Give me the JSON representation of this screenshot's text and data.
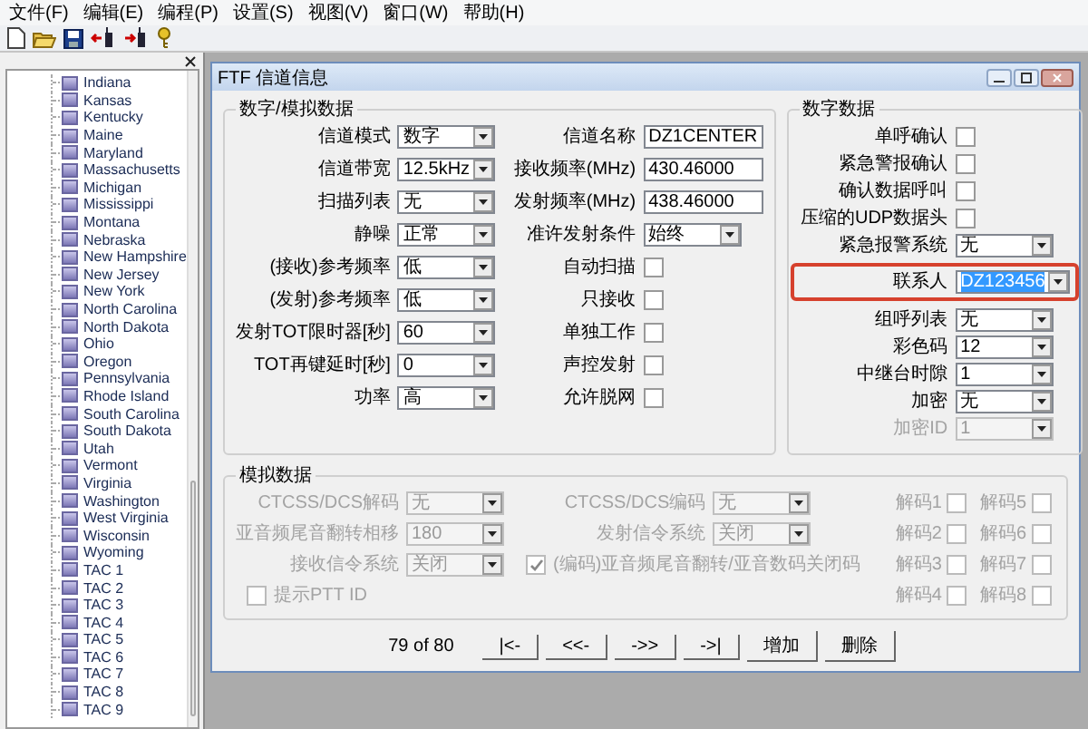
{
  "menu": [
    "文件(F)",
    "编辑(E)",
    "编程(P)",
    "设置(S)",
    "视图(V)",
    "窗口(W)",
    "帮助(H)"
  ],
  "tree": {
    "items": [
      "Indiana",
      "Kansas",
      "Kentucky",
      "Maine",
      "Maryland",
      "Massachusetts",
      "Michigan",
      "Mississippi",
      "Montana",
      "Nebraska",
      "New Hampshire",
      "New Jersey",
      "New York",
      "North Carolina",
      "North Dakota",
      "Ohio",
      "Oregon",
      "Pennsylvania",
      "Rhode Island",
      "South Carolina",
      "South Dakota",
      "Utah",
      "Vermont",
      "Virginia",
      "Washington",
      "West Virginia",
      "Wisconsin",
      "Wyoming",
      "TAC 1",
      "TAC 2",
      "TAC 3",
      "TAC 4",
      "TAC 5",
      "TAC 6",
      "TAC 7",
      "TAC 8",
      "TAC 9"
    ]
  },
  "dialog": {
    "title": "FTF 信道信息",
    "general": {
      "title": "数字/模拟数据",
      "left": [
        {
          "kind": "select",
          "label": "信道模式",
          "value": "数字"
        },
        {
          "kind": "select",
          "label": "信道带宽",
          "value": "12.5kHz"
        },
        {
          "kind": "select",
          "label": "扫描列表",
          "value": "无"
        },
        {
          "kind": "select",
          "label": "静噪",
          "value": "正常"
        },
        {
          "kind": "select",
          "label": "(接收)参考频率",
          "value": "低"
        },
        {
          "kind": "select",
          "label": "(发射)参考频率",
          "value": "低"
        },
        {
          "kind": "select",
          "label": "发射TOT限时器[秒]",
          "value": "60"
        },
        {
          "kind": "select",
          "label": "TOT再键延时[秒]",
          "value": "0"
        },
        {
          "kind": "select",
          "label": "功率",
          "value": "高"
        }
      ],
      "right": [
        {
          "kind": "input",
          "label": "信道名称",
          "value": "DZ1CENTER"
        },
        {
          "kind": "input",
          "label": "接收频率(MHz)",
          "value": "430.46000"
        },
        {
          "kind": "input",
          "label": "发射频率(MHz)",
          "value": "438.46000"
        },
        {
          "kind": "select",
          "label": "准许发射条件",
          "value": "始终"
        },
        {
          "kind": "checkbox",
          "label": "自动扫描",
          "checked": false
        },
        {
          "kind": "checkbox",
          "label": "只接收",
          "checked": false
        },
        {
          "kind": "checkbox",
          "label": "单独工作",
          "checked": false
        },
        {
          "kind": "checkbox",
          "label": "声控发射",
          "checked": false
        },
        {
          "kind": "checkbox",
          "label": "允许脱网",
          "checked": false
        }
      ]
    },
    "digital": {
      "title": "数字数据",
      "rows": [
        {
          "kind": "checkbox",
          "label": "单呼确认",
          "checked": false,
          "highlighted": false,
          "disabled": false
        },
        {
          "kind": "checkbox",
          "label": "紧急警报确认",
          "checked": false,
          "highlighted": false,
          "disabled": false
        },
        {
          "kind": "checkbox",
          "label": "确认数据呼叫",
          "checked": false,
          "highlighted": false,
          "disabled": false
        },
        {
          "kind": "checkbox",
          "label": "压缩的UDP数据头",
          "checked": false,
          "highlighted": false,
          "disabled": false
        },
        {
          "kind": "select",
          "label": "紧急报警系统",
          "value": "无",
          "highlighted": false,
          "disabled": false
        },
        {
          "kind": "select",
          "label": "联系人",
          "value": "DZ123456",
          "highlighted": true,
          "disabled": false
        },
        {
          "kind": "select",
          "label": "组呼列表",
          "value": "无",
          "highlighted": false,
          "disabled": false
        },
        {
          "kind": "select",
          "label": "彩色码",
          "value": "12",
          "highlighted": false,
          "disabled": false
        },
        {
          "kind": "select",
          "label": "中继台时隙",
          "value": "1",
          "highlighted": false,
          "disabled": false
        },
        {
          "kind": "select",
          "label": "加密",
          "value": "无",
          "highlighted": false,
          "disabled": false
        },
        {
          "kind": "select",
          "label": "加密ID",
          "value": "1",
          "highlighted": false,
          "disabled": true
        }
      ]
    },
    "analog": {
      "title": "模拟数据",
      "disabled": true,
      "left": [
        {
          "kind": "select",
          "label": "CTCSS/DCS解码",
          "value": "无"
        },
        {
          "kind": "select",
          "label": "亚音频尾音翻转相移",
          "value": "180"
        },
        {
          "kind": "select",
          "label": "接收信令系统",
          "value": "关闭"
        },
        {
          "kind": "checkbox",
          "label": "提示PTT ID",
          "checked": false
        }
      ],
      "middle": [
        {
          "kind": "select",
          "label": "CTCSS/DCS编码",
          "value": "无"
        },
        {
          "kind": "select",
          "label": "发射信令系统",
          "value": "关闭"
        },
        {
          "kind": "checkbox",
          "label": "(编码)亚音频尾音翻转/亚音数码关闭码",
          "checked": true
        }
      ],
      "decode": [
        {
          "kind": "checkbox",
          "label": "解码1",
          "checked": false
        },
        {
          "kind": "checkbox",
          "label": "解码5",
          "checked": false
        },
        {
          "kind": "checkbox",
          "label": "解码2",
          "checked": false
        },
        {
          "kind": "checkbox",
          "label": "解码6",
          "checked": false
        },
        {
          "kind": "checkbox",
          "label": "解码3",
          "checked": false
        },
        {
          "kind": "checkbox",
          "label": "解码7",
          "checked": false
        },
        {
          "kind": "checkbox",
          "label": "解码4",
          "checked": false
        },
        {
          "kind": "checkbox",
          "label": "解码8",
          "checked": false
        }
      ]
    },
    "nav": {
      "position": "79 of 80",
      "buttons": [
        "|<-",
        "<<-",
        "->>",
        "->|",
        "增加",
        "删除"
      ]
    }
  }
}
